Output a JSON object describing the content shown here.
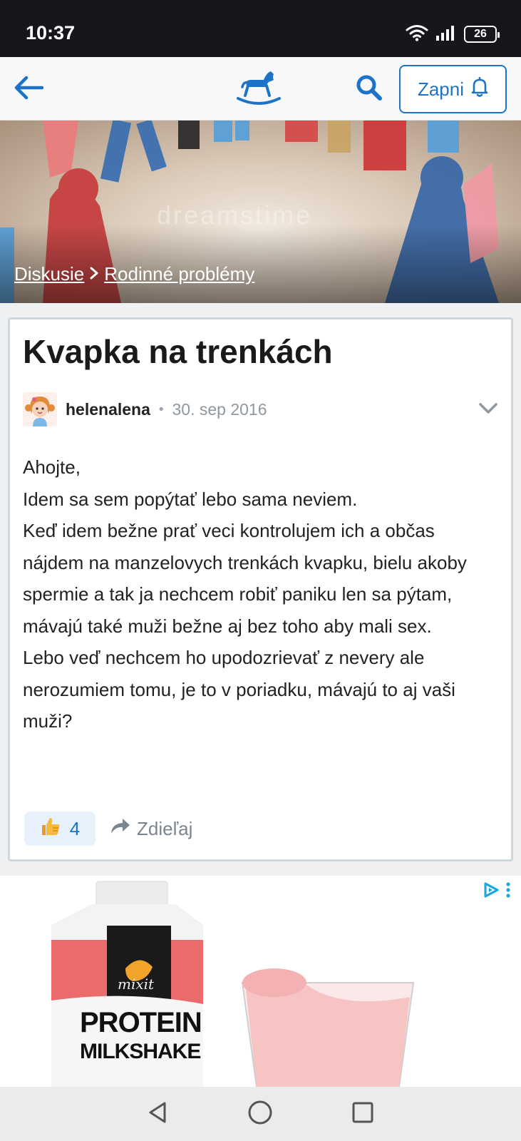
{
  "status_bar": {
    "time": "10:37",
    "battery": "26",
    "icons": [
      "wifi-icon",
      "signal-icon",
      "battery-icon"
    ]
  },
  "app_bar": {
    "back_icon": "arrow-left-icon",
    "logo_icon": "rocking-horse-icon",
    "search_icon": "search-icon",
    "notify_label": "Zapni",
    "notify_icon": "bell-icon",
    "accent_color": "#1e73c8"
  },
  "hero": {
    "watermark": "dreamstime",
    "breadcrumb": [
      {
        "label": "Diskusie"
      },
      {
        "label": "Rodinné problémy"
      }
    ]
  },
  "post": {
    "title": "Kvapka na trenkách",
    "author": "helenalena",
    "date": "30. sep 2016",
    "body": [
      "Ahojte,",
      "Idem sa sem popýtať lebo sama neviem.",
      "Keď idem bežne prať veci kontrolujem ich a občas nájdem na manzelovych trenkách kvapku, bielu akoby spermie a tak ja nechcem robiť paniku len sa pýtam, mávajú také muži bežne aj bez toho aby mali sex.",
      "Lebo veď nechcem ho upodozrievať z nevery ale nerozumiem tomu, je to v poriadku, mávajú to aj vaši muži?"
    ],
    "like_count": "4",
    "share_label": "Zdieľaj"
  },
  "ad": {
    "brand": "mixit",
    "product_line1": "PROTEIN",
    "product_line2": "MILKSHAKE"
  },
  "nav_bar": {
    "icons": [
      "back-triangle-icon",
      "home-circle-icon",
      "recents-square-icon"
    ]
  }
}
